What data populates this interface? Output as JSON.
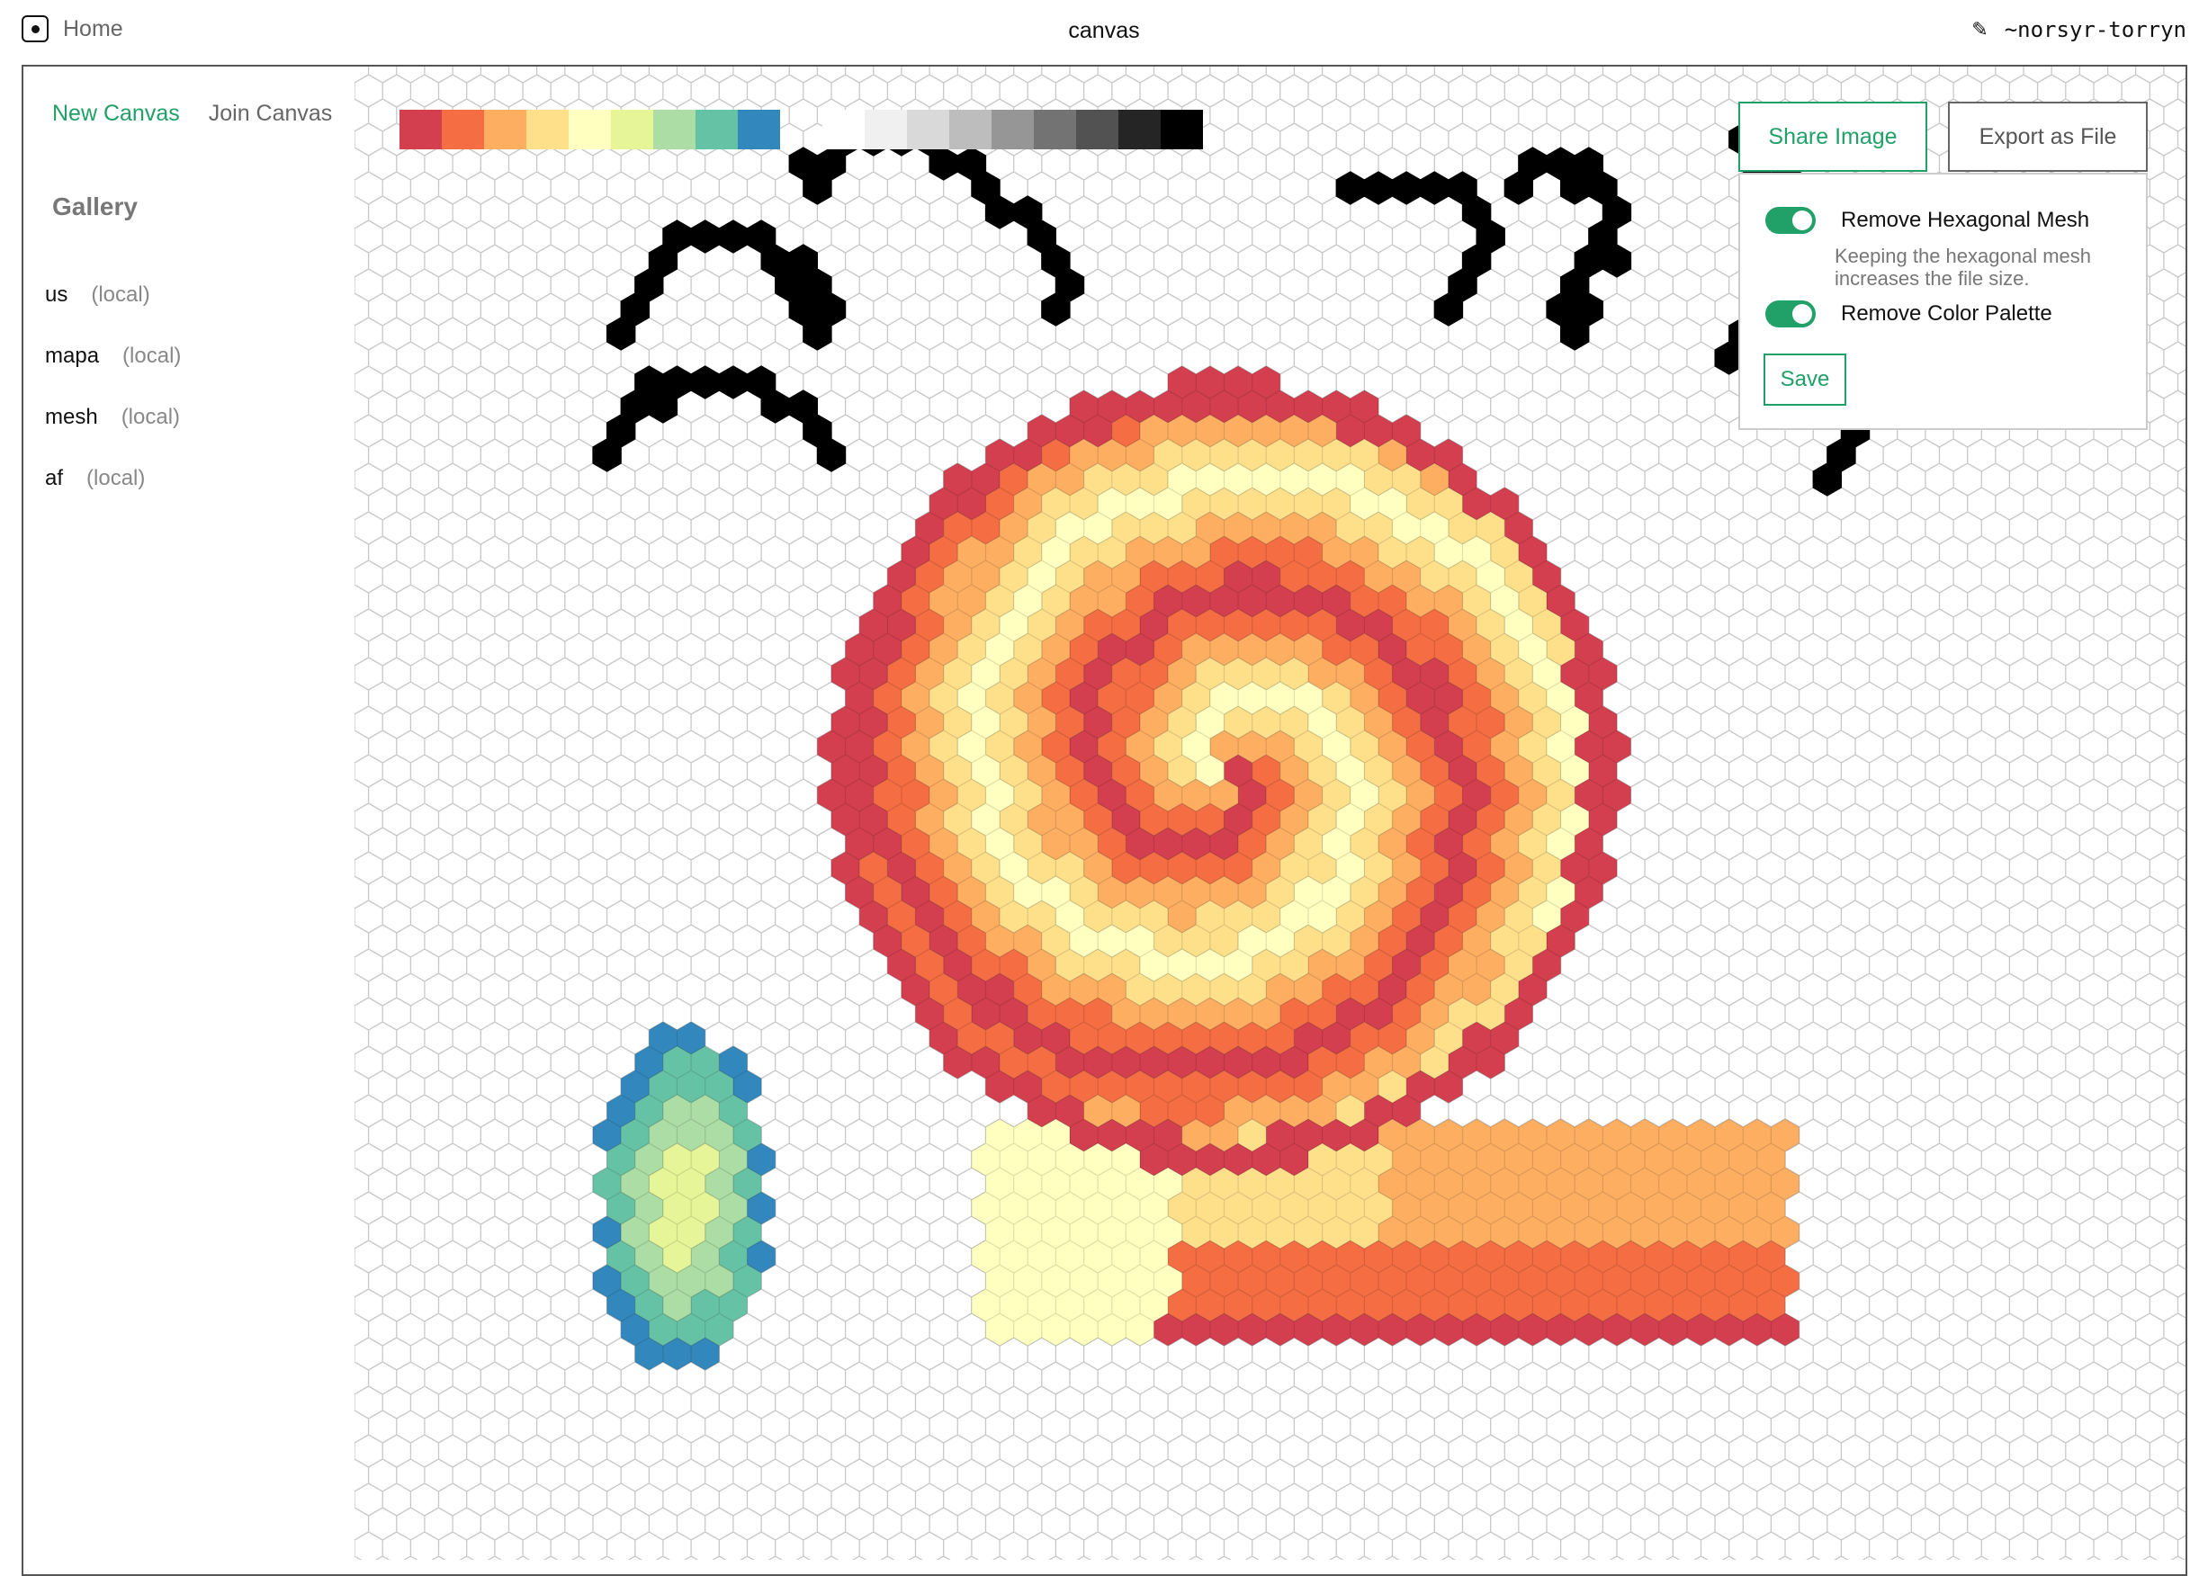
{
  "header": {
    "home_label": "Home",
    "title": "canvas",
    "user": "~norsyr-torryn",
    "icons": [
      "home-icon",
      "pencil-icon"
    ]
  },
  "sidebar": {
    "new_canvas": "New Canvas",
    "join_canvas": "Join Canvas",
    "gallery_title": "Gallery",
    "items": [
      {
        "name": "us",
        "tag": "(local)"
      },
      {
        "name": "mapa",
        "tag": "(local)"
      },
      {
        "name": "mesh",
        "tag": "(local)"
      },
      {
        "name": "af",
        "tag": "(local)"
      }
    ]
  },
  "palette": [
    "#d33f4f",
    "#f46d43",
    "#fdae61",
    "#fee08b",
    "#ffffbf",
    "#e6f598",
    "#abdda4",
    "#66c2a5",
    "#3288bd",
    "#ffffff",
    "#f0f0f0",
    "#d9d9d9",
    "#bdbdbd",
    "#969696",
    "#737373",
    "#525252",
    "#252525",
    "#000000"
  ],
  "export": {
    "share_label": "Share Image",
    "export_label": "Export as File",
    "opt_mesh": {
      "label": "Remove Hexagonal Mesh",
      "enabled": true
    },
    "mesh_hint": "Keeping the hexagonal mesh increases the file size.",
    "opt_palette": {
      "label": "Remove Color Palette",
      "enabled": true
    },
    "save_label": "Save"
  },
  "colors": {
    "accent": "#21a068",
    "mesh": "#c8c8c8"
  }
}
